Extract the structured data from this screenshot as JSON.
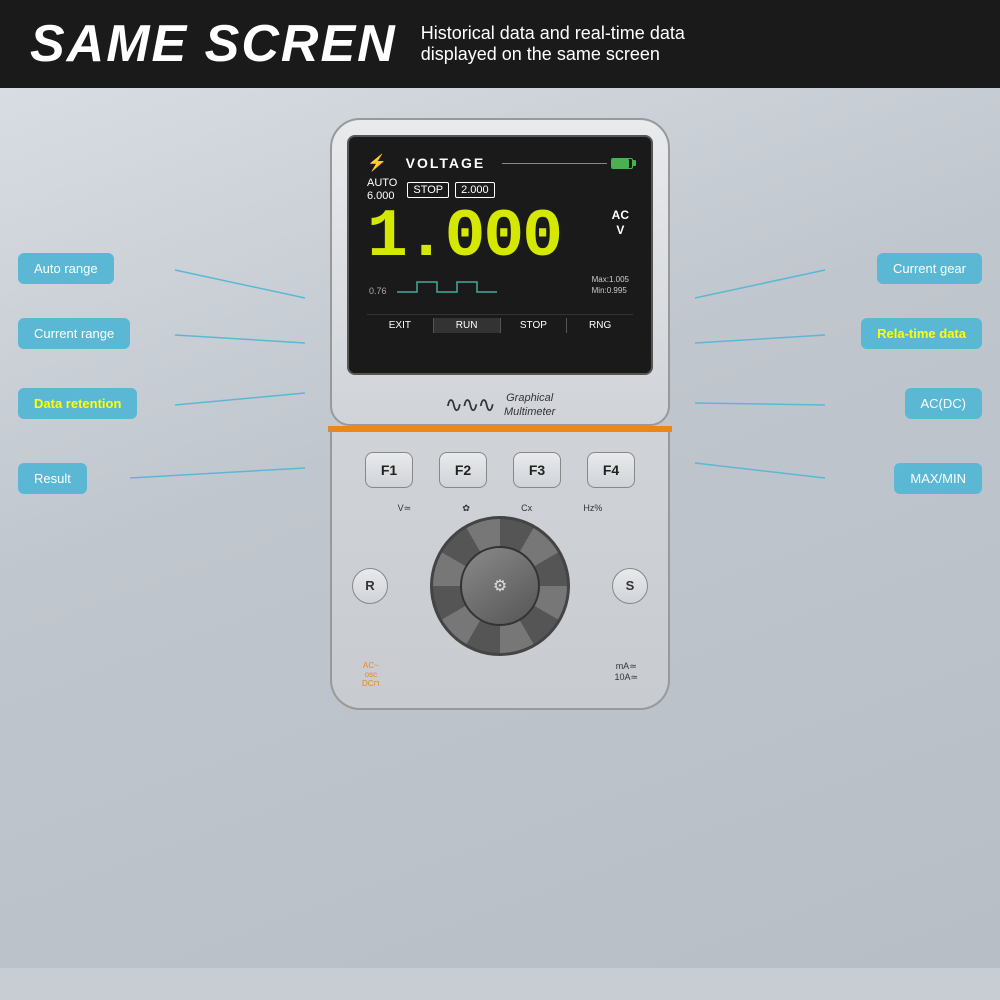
{
  "header": {
    "title_big": "SAME SCREN",
    "subtitle_line1": "Historical data and real-time data",
    "subtitle_line2": "displayed on the same screen"
  },
  "screen": {
    "voltage_label": "VOLTAGE",
    "auto_label": "AUTO",
    "range_value": "6.000",
    "stop_label": "STOP",
    "stop_value": "2.000",
    "big_number": "1.000",
    "ac_label": "AC",
    "v_label": "V",
    "waveform_left": "0.76",
    "max_label": "Max:1.005",
    "min_label": "Min:0.995",
    "btn_exit": "EXIT",
    "btn_run": "RUN",
    "btn_stop": "STOP",
    "btn_rng": "RNG"
  },
  "device": {
    "brand_label": "Graphical",
    "brand_label2": "Multimeter",
    "f_buttons": [
      "F1",
      "F2",
      "F3",
      "F4"
    ],
    "left_button": "R",
    "right_button": "S",
    "knob_labels_top": [
      "V≃",
      "✿",
      "Cx",
      "Hz%"
    ],
    "knob_labels_bottom": [
      "AC~\nosc",
      "DC⊓",
      "mA≃",
      "10A≃"
    ]
  },
  "annotations": {
    "auto_range": "Auto range",
    "current_range": "Current range",
    "data_retention": "Data retention",
    "result": "Result",
    "current_gear": "Current gear",
    "rela_time_data": "Rela-time data",
    "ac_dc": "AC(DC)",
    "max_min": "MAX/MIN"
  }
}
